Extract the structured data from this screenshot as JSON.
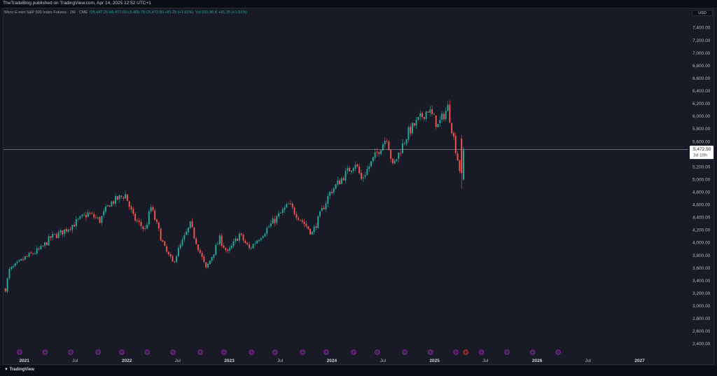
{
  "header": {
    "publisher": "TheTradeBlog published on TradingView.com, Apr 14, 2025 12:52 UTC+1"
  },
  "legend": {
    "symbol": "Micro E-mini S&P 500 Index Futures · 1W · CME",
    "ohlc": "O5,447.25 H5,477.00 L5,409.75 C5,472.50 +81.25 (+1.51%)",
    "volume": "Vol 291.96 K +81.25 (+1.51%)"
  },
  "currency": "USD",
  "price_label": {
    "value": "5,472.50",
    "countdown": "3d 10h"
  },
  "footer": {
    "brand": "TradingView"
  },
  "colors": {
    "up": "#26a69a",
    "down": "#ef5350",
    "background": "#181b25",
    "event_marker": "#9c27b0",
    "event_marker_active": "#e53935"
  },
  "icons": {
    "event": "calendar-event-icon",
    "logo": "tradingview-logo-icon"
  },
  "chart_data": {
    "type": "candlestick",
    "instrument": "Micro E-mini S&P 500 Index Futures",
    "interval": "1W",
    "ylim": [
      2300,
      7550
    ],
    "y_ticks": [
      "7,400.00",
      "7,200.00",
      "7,000.00",
      "6,800.00",
      "6,600.00",
      "6,400.00",
      "6,200.00",
      "6,000.00",
      "5,800.00",
      "5,600.00",
      "5,400.00",
      "5,200.00",
      "5,000.00",
      "4,800.00",
      "4,600.00",
      "4,400.00",
      "4,200.00",
      "4,000.00",
      "3,800.00",
      "3,600.00",
      "3,400.00",
      "3,200.00",
      "3,000.00",
      "2,800.00",
      "2,600.00",
      "2,400.00"
    ],
    "x_ticks": [
      "2021",
      "Jul",
      "2022",
      "Jul",
      "2023",
      "Jul",
      "2024",
      "Jul",
      "2025",
      "Jul",
      "2026",
      "Jul",
      "2027"
    ],
    "last_price": 5472.5,
    "close_path": [
      [
        "2020-10-26",
        3270
      ],
      [
        "2020-11-09",
        3560
      ],
      [
        "2020-12-14",
        3680
      ],
      [
        "2021-01-04",
        3760
      ],
      [
        "2021-03-01",
        3900
      ],
      [
        "2021-04-05",
        4080
      ],
      [
        "2021-05-10",
        4150
      ],
      [
        "2021-06-28",
        4300
      ],
      [
        "2021-08-16",
        4460
      ],
      [
        "2021-09-27",
        4350
      ],
      [
        "2021-11-01",
        4620
      ],
      [
        "2021-12-27",
        4760
      ],
      [
        "2022-01-24",
        4400
      ],
      [
        "2022-03-07",
        4200
      ],
      [
        "2022-03-28",
        4560
      ],
      [
        "2022-05-16",
        3900
      ],
      [
        "2022-06-13",
        3680
      ],
      [
        "2022-08-15",
        4280
      ],
      [
        "2022-10-10",
        3580
      ],
      [
        "2022-11-28",
        4060
      ],
      [
        "2022-12-26",
        3830
      ],
      [
        "2023-02-06",
        4130
      ],
      [
        "2023-03-13",
        3900
      ],
      [
        "2023-05-01",
        4150
      ],
      [
        "2023-07-31",
        4600
      ],
      [
        "2023-10-23",
        4150
      ],
      [
        "2023-12-25",
        4790
      ],
      [
        "2024-03-25",
        5270
      ],
      [
        "2024-04-15",
        5000
      ],
      [
        "2024-07-15",
        5680
      ],
      [
        "2024-08-05",
        5200
      ],
      [
        "2024-09-30",
        5750
      ],
      [
        "2024-12-09",
        6110
      ],
      [
        "2025-01-13",
        5850
      ],
      [
        "2025-02-17",
        6140
      ],
      [
        "2025-03-10",
        5650
      ],
      [
        "2025-04-07",
        5000
      ],
      [
        "2025-04-14",
        5472.5
      ]
    ],
    "events": [
      "2020-12-15",
      "2021-03-16",
      "2021-06-15",
      "2021-09-21",
      "2021-12-14",
      "2022-03-15",
      "2022-06-14",
      "2022-09-20",
      "2022-12-13",
      "2023-03-21",
      "2023-06-13",
      "2023-09-19",
      "2023-12-12",
      "2024-03-19",
      "2024-06-11",
      "2024-09-17",
      "2024-12-17",
      "2025-03-18",
      "2025-04-22",
      "2025-06-17",
      "2025-09-16",
      "2025-12-16",
      "2026-03-17"
    ],
    "active_event": "2025-04-22"
  }
}
